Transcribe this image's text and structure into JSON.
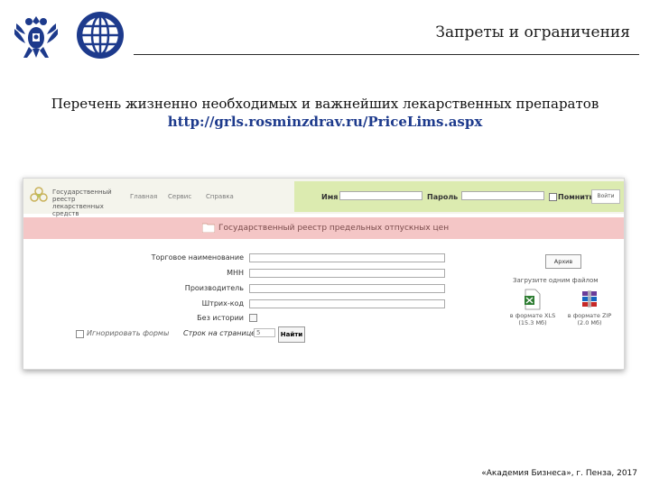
{
  "slide": {
    "title": "Запреты и ограничения",
    "heading": "Перечень жизненно необходимых и важнейших лекарственных препаратов",
    "url": "http://grls.rosminzdrav.ru/PriceLims.aspx",
    "footer": "«Академия Бизнеса», г. Пенза, 2017"
  },
  "site": {
    "name": "Государственный реестр лекарственных средств",
    "nav": [
      "Главная",
      "Сервис",
      "Справка"
    ],
    "login": {
      "name_label": "Имя",
      "password_label": "Пароль",
      "remember_label": "Помнить",
      "button": "Войти"
    },
    "section_title": "Государственный реестр предельных отпускных цен",
    "form": {
      "fields": [
        "Торговое наименование",
        "МНН",
        "Производитель",
        "Штрих-код"
      ],
      "no_history_label": "Без истории",
      "ignore_forms_label": "Игнорировать формы",
      "rows_per_page_label": "Строк на странице",
      "rows_per_page_value": "5",
      "find_button": "Найти"
    },
    "archive_button": "Архив",
    "download": {
      "title": "Загрузите одним файлом",
      "files": [
        {
          "label": "в формате XLS",
          "size": "(15.3 Мб)"
        },
        {
          "label": "в формате ZIP",
          "size": "(2.0 Мб)"
        }
      ]
    }
  },
  "colors": {
    "url": "#1d3a8c",
    "site_header_green": "#dcebb0",
    "section_band": "#f4c6c6"
  }
}
